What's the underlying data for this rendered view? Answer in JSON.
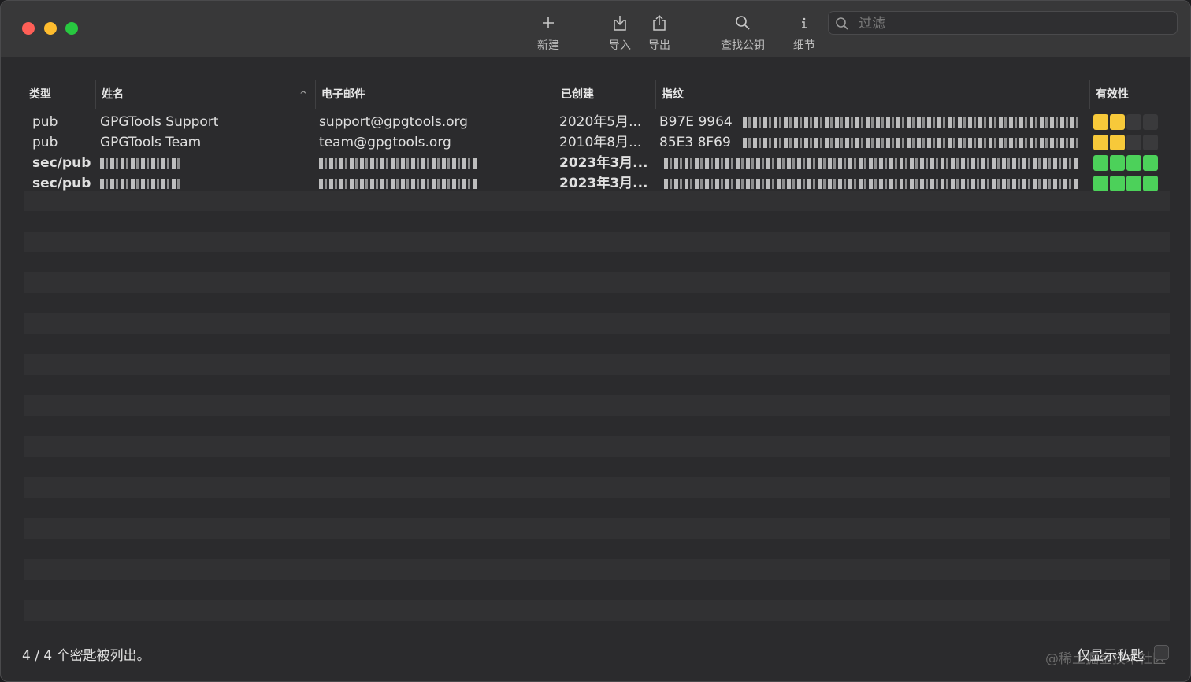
{
  "toolbar": {
    "new_label": "新建",
    "import_label": "导入",
    "export_label": "导出",
    "lookup_label": "查找公钥",
    "details_label": "细节"
  },
  "search": {
    "placeholder": "过滤",
    "value": ""
  },
  "columns": {
    "type": "类型",
    "name": "姓名",
    "email": "电子邮件",
    "created": "已创建",
    "fingerprint": "指纹",
    "validity": "有效性"
  },
  "keys": [
    {
      "type": "pub",
      "name": "GPGTools Support",
      "email": "support@gpgtools.org",
      "created": "2020年5月...",
      "fingerprint": "B97E  9964",
      "validity_level": 2,
      "validity_color": "#f7c93a"
    },
    {
      "type": "pub",
      "name": "GPGTools Team",
      "email": "team@gpgtools.org",
      "created": "2010年8月...",
      "fingerprint": "85E3  8F69",
      "validity_level": 2,
      "validity_color": "#f7c93a"
    },
    {
      "type": "sec/pub",
      "name": "",
      "email": "",
      "created": "2023年3月...",
      "fingerprint": "",
      "validity_level": 4,
      "validity_color": "#4cd15a"
    },
    {
      "type": "sec/pub",
      "name": "",
      "email": "",
      "created": "2023年3月...",
      "fingerprint": "",
      "validity_level": 4,
      "validity_color": "#4cd15a"
    }
  ],
  "status": {
    "count_text": "4 / 4 个密匙被列出。"
  },
  "footer": {
    "only_secret_label": "仅显示私匙",
    "watermark": "@稀土掘金技术社区"
  }
}
